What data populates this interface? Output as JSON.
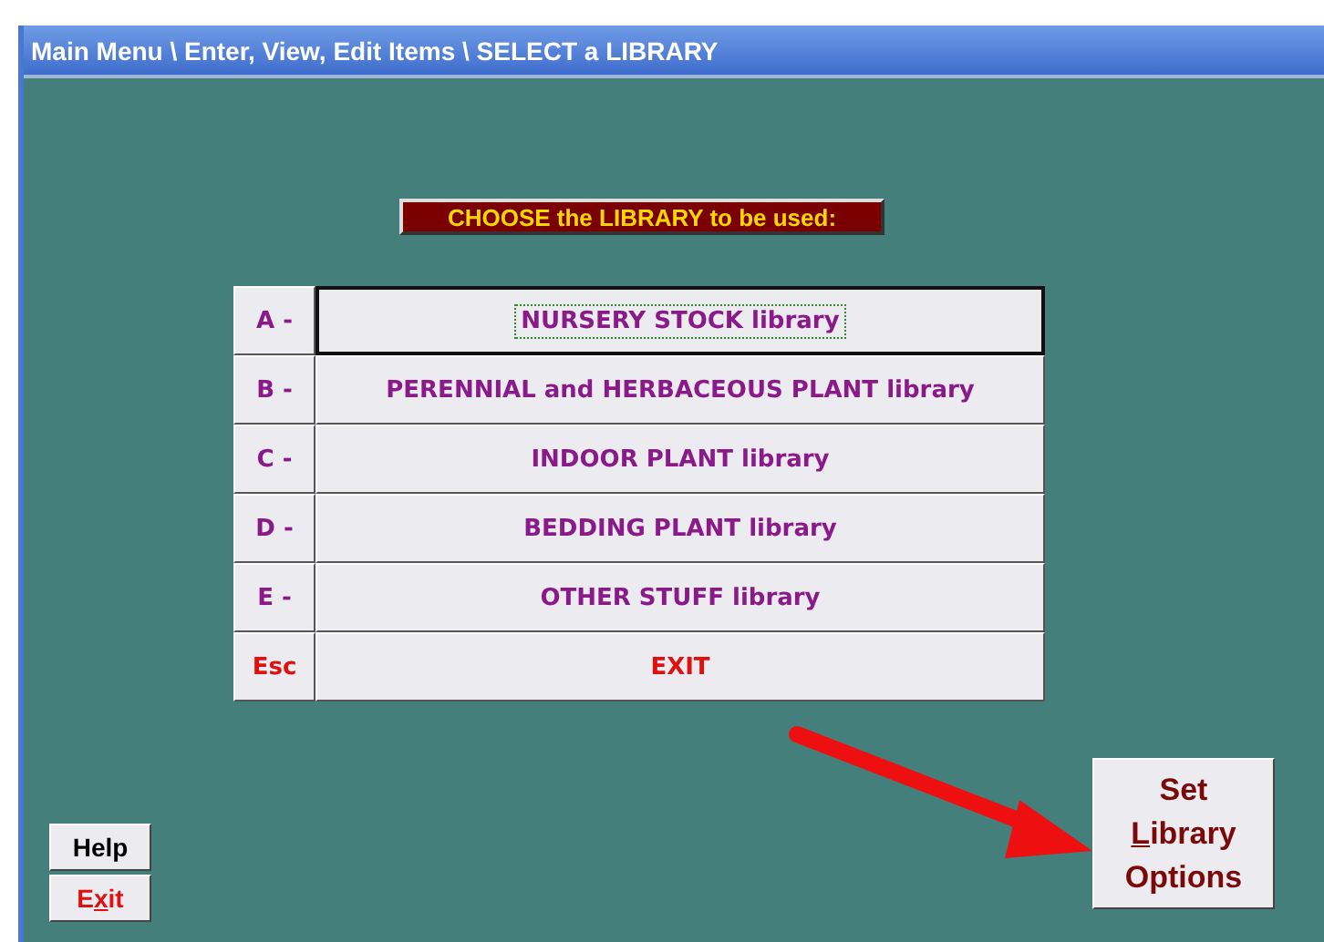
{
  "window": {
    "title": "Main Menu \\ Enter, View, Edit Items \\ SELECT a LIBRARY"
  },
  "heading": "CHOOSE the LIBRARY to be used:",
  "libraries": [
    {
      "key": "A -",
      "label": "NURSERY STOCK library",
      "kind": "library",
      "selected": true
    },
    {
      "key": "B -",
      "label": "PERENNIAL and HERBACEOUS PLANT library",
      "kind": "library",
      "selected": false
    },
    {
      "key": "C -",
      "label": "INDOOR PLANT library",
      "kind": "library",
      "selected": false
    },
    {
      "key": "D -",
      "label": "BEDDING PLANT library",
      "kind": "library",
      "selected": false
    },
    {
      "key": "E -",
      "label": "OTHER STUFF library",
      "kind": "library",
      "selected": false
    },
    {
      "key": "Esc",
      "label": "EXIT",
      "kind": "exit",
      "selected": false
    }
  ],
  "buttons": [
    {
      "label": "Help",
      "kind": "help"
    },
    {
      "label_parts": [
        {
          "text": "E",
          "underlined": false
        },
        {
          "text": "x",
          "underlined": true
        },
        {
          "text": "it",
          "underlined": false
        }
      ],
      "kind": "exit"
    }
  ],
  "options_button": {
    "lines": [
      [
        {
          "text": "Set",
          "underlined": false
        }
      ],
      [
        {
          "text": "L",
          "underlined": true
        },
        {
          "text": "ibrary",
          "underlined": false
        }
      ],
      [
        {
          "text": "Options",
          "underlined": false
        }
      ]
    ]
  }
}
